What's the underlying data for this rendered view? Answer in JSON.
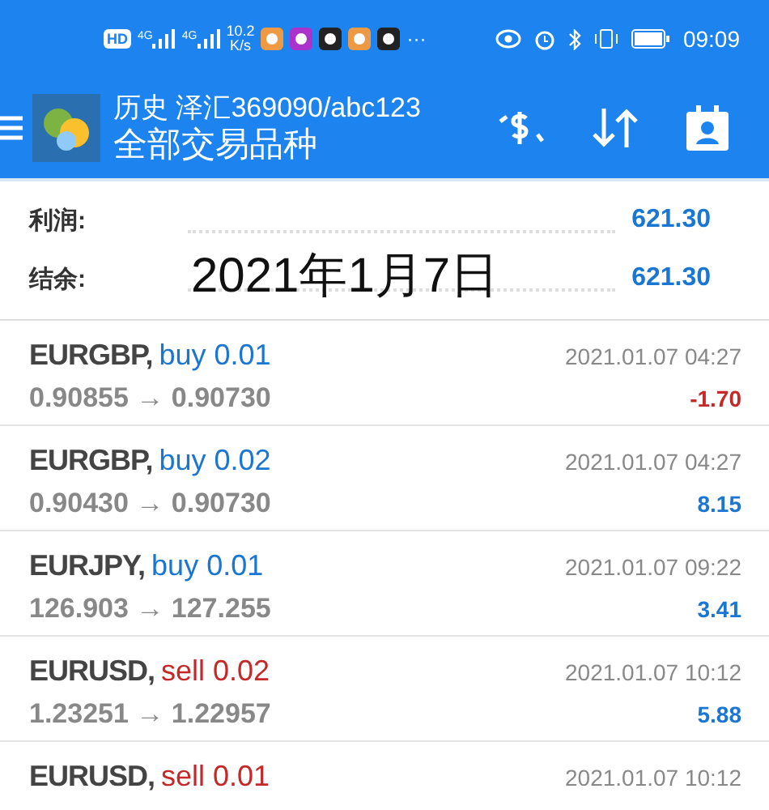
{
  "status_bar": {
    "hd": "HD",
    "signals": [
      "4G",
      "4G"
    ],
    "speed": "10.2",
    "speed_unit": "K/s",
    "more": "···",
    "time": "09:09"
  },
  "header": {
    "title": "历史 泽汇369090/abc123",
    "subtitle": "全部交易品种"
  },
  "summary": [
    {
      "label": "利润:",
      "value": "621.30"
    },
    {
      "label": "结余:",
      "value": "621.30"
    }
  ],
  "caption": "2021年1月7日",
  "trades": [
    {
      "symbol": "EURGBP,",
      "kind": "buy",
      "order": "buy 0.01",
      "time": "2021.01.07 04:27",
      "prices": "0.90855 → 0.90730",
      "profit": "-1.70",
      "loss": true
    },
    {
      "symbol": "EURGBP,",
      "kind": "buy",
      "order": "buy 0.02",
      "time": "2021.01.07 04:27",
      "prices": "0.90430 → 0.90730",
      "profit": "8.15",
      "loss": false
    },
    {
      "symbol": "EURJPY,",
      "kind": "buy",
      "order": "buy 0.01",
      "time": "2021.01.07 09:22",
      "prices": "126.903 → 127.255",
      "profit": "3.41",
      "loss": false
    },
    {
      "symbol": "EURUSD,",
      "kind": "sell",
      "order": "sell 0.02",
      "time": "2021.01.07 10:12",
      "prices": "1.23251 → 1.22957",
      "profit": "5.88",
      "loss": false
    },
    {
      "symbol": "EURUSD,",
      "kind": "sell",
      "order": "sell 0.01",
      "time": "2021.01.07 10:12"
    }
  ]
}
